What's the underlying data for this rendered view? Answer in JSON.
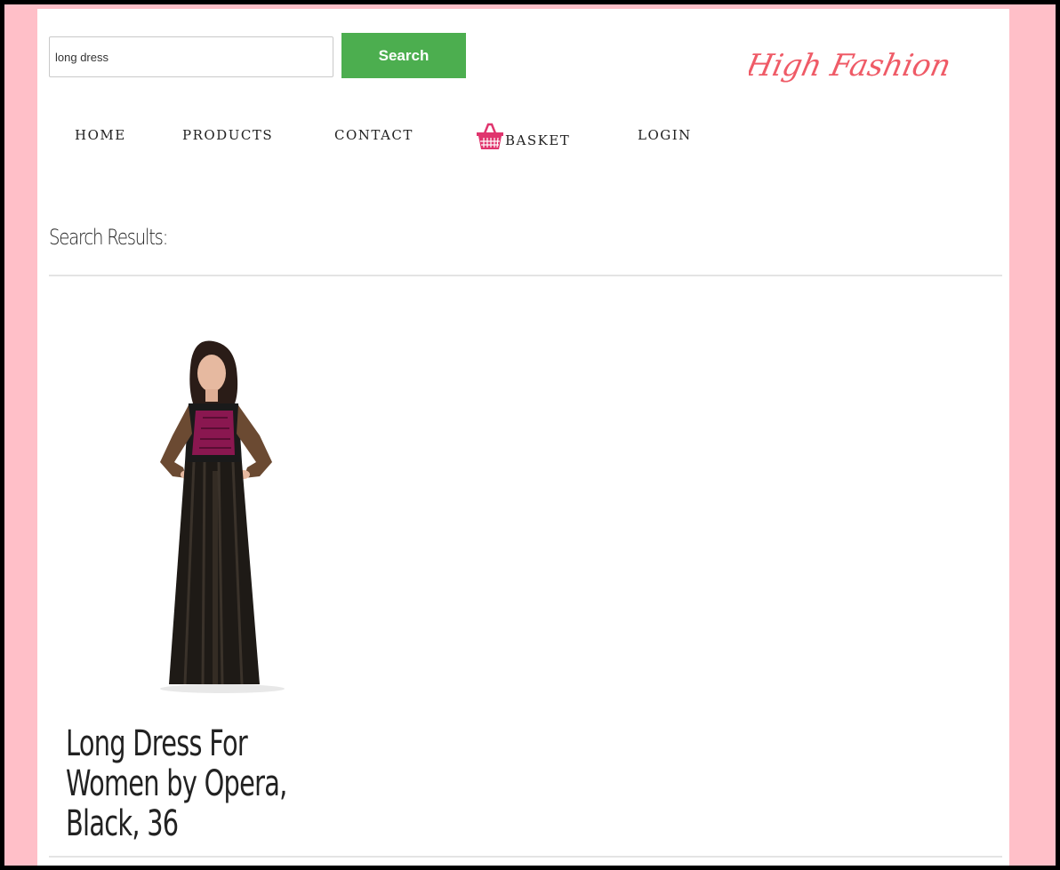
{
  "search": {
    "value": "long dress",
    "button_label": "Search"
  },
  "logo": {
    "text": "High Fashion",
    "color": "#ef5b67"
  },
  "nav": {
    "home": "HOME",
    "products": "PRODUCTS",
    "contact": "CONTACT",
    "basket": "BASKET",
    "login": "LOGIN"
  },
  "results": {
    "title": "Search Results:"
  },
  "products": [
    {
      "name": "Long Dress For Women by Opera, Black, 36"
    }
  ],
  "colors": {
    "side_background": "#ffbfc8",
    "search_button": "#4cae4f",
    "basket_icon": "#e0356e"
  },
  "icons": {
    "basket": "basket-icon"
  }
}
